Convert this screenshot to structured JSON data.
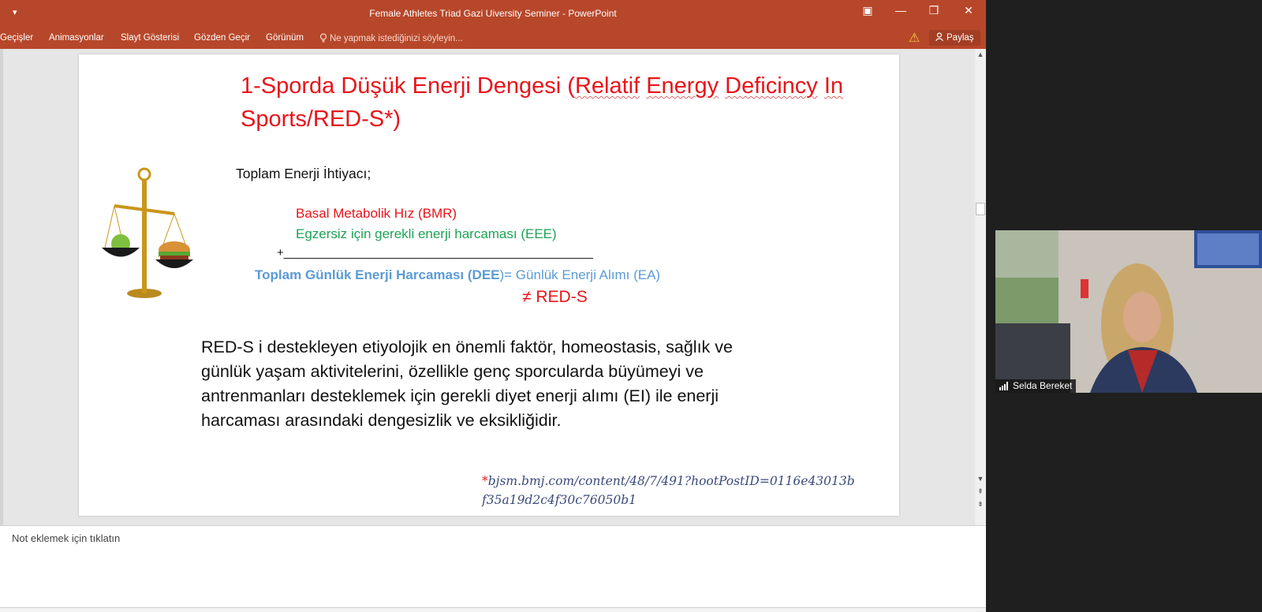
{
  "window": {
    "title": "Female Athletes Triad Gazi Uiversity Seminer - PowerPoint",
    "controls": [
      "▣",
      "—",
      "❐",
      "✕"
    ]
  },
  "ribbon": {
    "tabs": [
      "Geçişler",
      "Animasyonlar",
      "Slayt Gösterisi",
      "Gözden Geçir",
      "Görünüm"
    ],
    "tell_me": "Ne yapmak istediğinizi söyleyin...",
    "share": "Paylaş"
  },
  "slide": {
    "title_segments": [
      {
        "text": "1-Sporda Düşük Enerji Dengesi (",
        "squiggle": false
      },
      {
        "text": "Relatif",
        "squiggle": true
      },
      {
        "text": " ",
        "squiggle": false
      },
      {
        "text": "Energy",
        "squiggle": true
      },
      {
        "text": " ",
        "squiggle": false
      },
      {
        "text": "Deficincy",
        "squiggle": true
      },
      {
        "text": " ",
        "squiggle": false
      },
      {
        "text": "In",
        "squiggle": true
      },
      {
        "text": " Sports/RED-S*)",
        "squiggle": false
      }
    ],
    "total_need": "Toplam Enerji İhtiyacı;",
    "bmr": "Basal Metabolik Hız (BMR)",
    "eee": "Egzersiz için gerekli enerji harcaması (EEE)",
    "plus_line": "+_______________________________________________",
    "dee_bold": "Toplam Günlük Enerji Harcaması  (DEE",
    "dee_rest": ")= Günlük Enerji Alımı (EA)",
    "neq": "≠ RED-S",
    "paragraph_lines": [
      "RED-S i destekleyen etiyolojik en önemli faktör, homeostasis,  sağlık ve",
      "günlük yaşam aktivitelerini, özellikle genç sporcularda büyümeyi ve",
      "antrenmanları desteklemek için gerekli diyet enerji alımı (EI) ile enerji",
      "harcaması arasındaki dengesizlik ve eksikliğidir."
    ],
    "reference_star": "*",
    "reference_line1": "bjsm.bmj.com/content/48/7/491?hootPostID=0116e43013b",
    "reference_line2": "f35a19d2c4f30c76050b1"
  },
  "notes_placeholder": "Not eklemek için tıklatın",
  "participant": {
    "name": "Selda Bereket"
  },
  "colors": {
    "titlebar": "#b7472a",
    "title_red": "#e8141b",
    "green": "#1da355",
    "blue": "#5b9bd5"
  }
}
